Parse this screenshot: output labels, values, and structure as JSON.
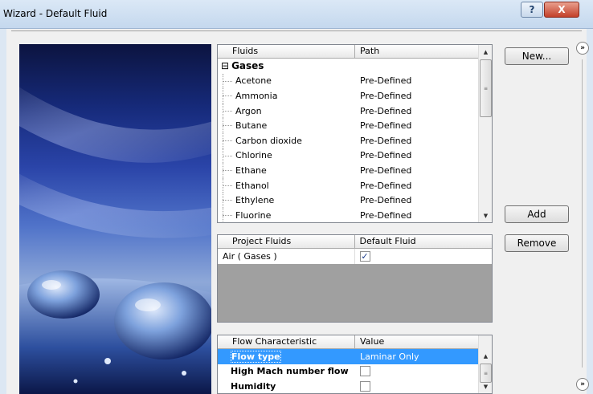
{
  "window": {
    "title": "Wizard - Default Fluid",
    "help_label": "?",
    "close_label": "X"
  },
  "fluids_table": {
    "columns": [
      "Fluids",
      "Path"
    ],
    "group": {
      "toggle": "⊟",
      "name": "Gases"
    },
    "rows": [
      {
        "name": "Acetone",
        "path": "Pre-Defined"
      },
      {
        "name": "Ammonia",
        "path": "Pre-Defined"
      },
      {
        "name": "Argon",
        "path": "Pre-Defined"
      },
      {
        "name": "Butane",
        "path": "Pre-Defined"
      },
      {
        "name": "Carbon dioxide",
        "path": "Pre-Defined"
      },
      {
        "name": "Chlorine",
        "path": "Pre-Defined"
      },
      {
        "name": "Ethane",
        "path": "Pre-Defined"
      },
      {
        "name": "Ethanol",
        "path": "Pre-Defined"
      },
      {
        "name": "Ethylene",
        "path": "Pre-Defined"
      },
      {
        "name": "Fluorine",
        "path": "Pre-Defined"
      }
    ]
  },
  "project_fluids_table": {
    "columns": [
      "Project Fluids",
      "Default Fluid"
    ],
    "rows": [
      {
        "name": "Air ( Gases )",
        "default": true
      }
    ]
  },
  "flow_table": {
    "columns": [
      "Flow Characteristic",
      "Value"
    ],
    "rows": [
      {
        "name": "Flow type",
        "value": "Laminar Only",
        "selected": true
      },
      {
        "name": "High Mach number flow",
        "value": "",
        "checkbox": true
      },
      {
        "name": "Humidity",
        "value": "",
        "checkbox": true
      }
    ]
  },
  "buttons": {
    "new": "New...",
    "add": "Add",
    "remove": "Remove"
  },
  "side_toggles": {
    "top": "»",
    "bottom": "»"
  },
  "colors": {
    "selection": "#3399ff",
    "disabled_area": "#a0a0a0"
  }
}
